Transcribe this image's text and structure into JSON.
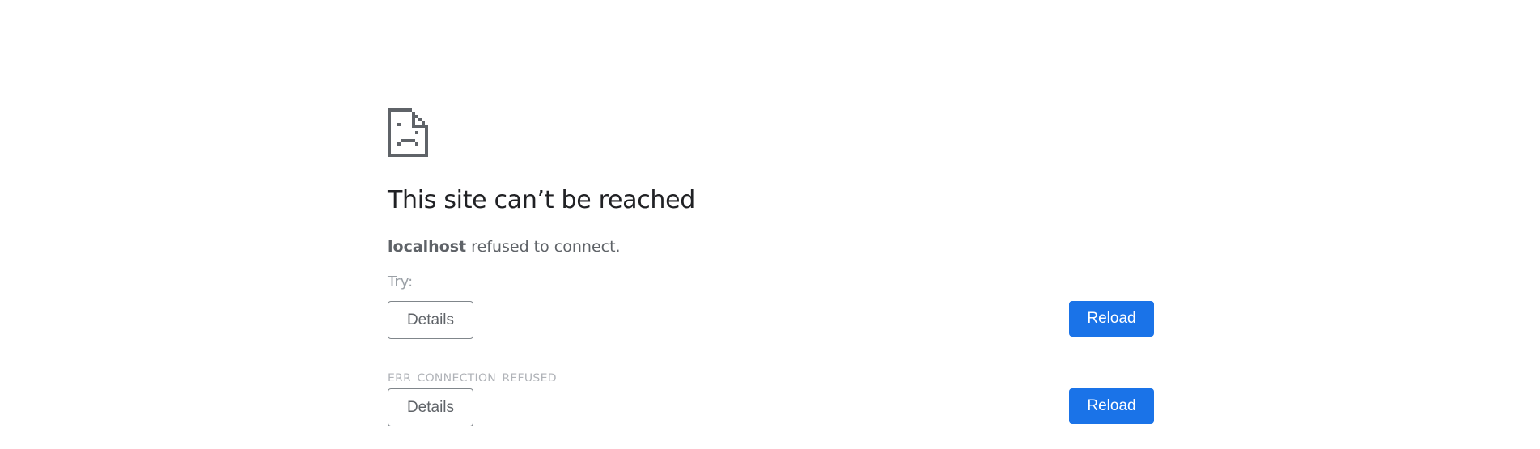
{
  "icon": "sad-page-icon",
  "heading": "This site can’t be reached",
  "summary": {
    "host": "localhost",
    "message": " refused to connect."
  },
  "suggestions_label": "Try:",
  "error_code": "ERR_CONNECTION_REFUSED",
  "buttons": {
    "details_label": "Details",
    "reload_label": "Reload"
  },
  "colors": {
    "primary_button": "#1a73e8",
    "icon": "#5f6368",
    "text_secondary": "#5f6368"
  }
}
